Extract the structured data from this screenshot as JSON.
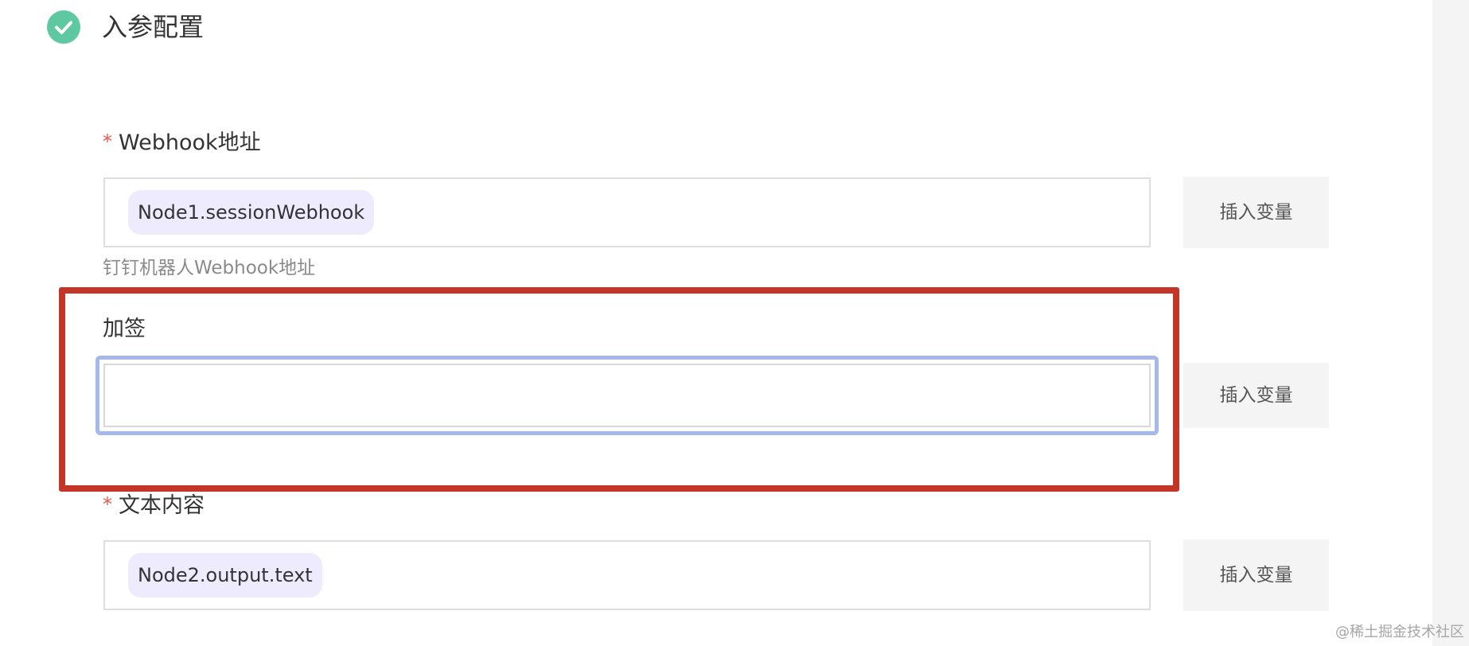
{
  "section": {
    "title": "入参配置",
    "icon": "check-circle-icon",
    "icon_color": "#5ec9a1"
  },
  "fields": {
    "webhook": {
      "required_mark": "*",
      "label": "Webhook地址",
      "value_tag": "Node1.sessionWebhook",
      "hint": "钉钉机器人Webhook地址",
      "insert_label": "插入变量"
    },
    "sign": {
      "label": "加签",
      "value": "",
      "insert_label": "插入变量"
    },
    "text": {
      "required_mark": "*",
      "label": "文本内容",
      "value_tag": "Node2.output.text",
      "insert_label": "插入变量"
    }
  },
  "colors": {
    "required": "#e05a4e",
    "variable_tag_bg": "#eeebff",
    "focus_ring": "#a3b9ee",
    "annotation_box": "#c33526"
  },
  "watermark": "@稀土掘金技术社区"
}
